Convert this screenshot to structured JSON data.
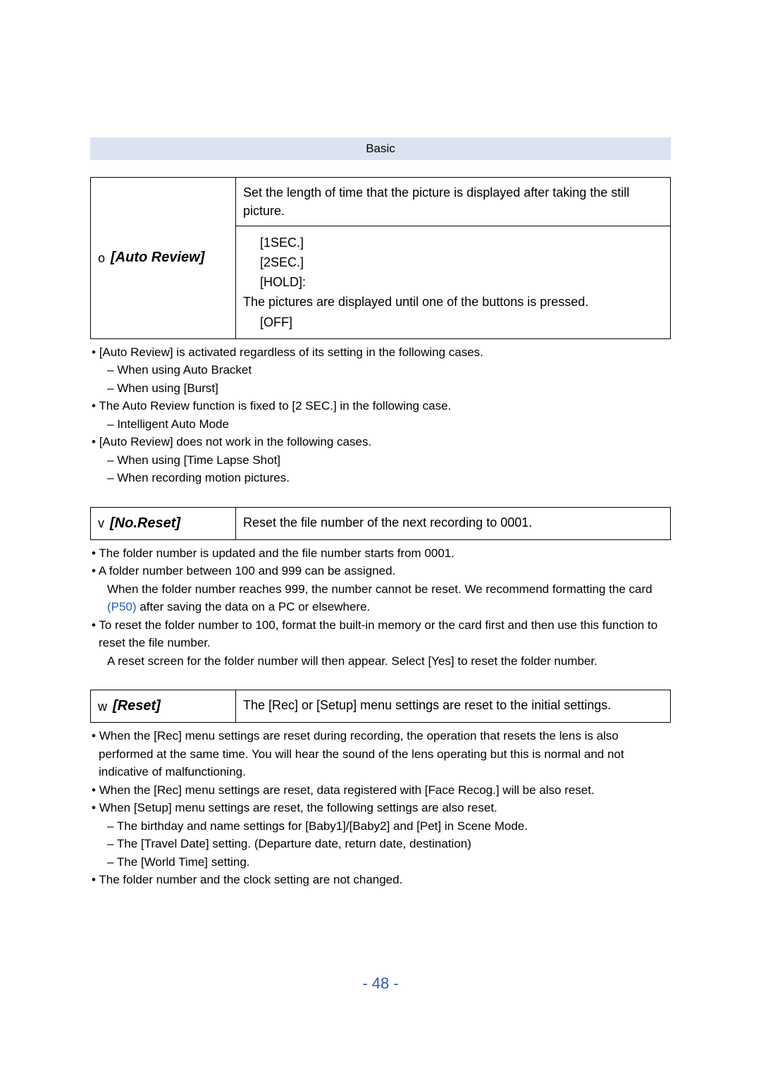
{
  "header": {
    "title": "Basic"
  },
  "section1": {
    "left_letter": "o",
    "left_glyph": "[Auto Review]",
    "desc": "Set the length of time that the picture is displayed after taking the still picture.",
    "options": [
      {
        "g": "",
        "t": "[1SEC.]"
      },
      {
        "g": "",
        "t": "[2SEC.]"
      },
      {
        "g": "",
        "t": "[HOLD]:"
      },
      {
        "g": "",
        "t": "The pictures are displayed until one of the buttons is pressed."
      },
      {
        "g": "",
        "t": "[OFF]"
      }
    ]
  },
  "notes1": {
    "n1": "[Auto Review] is activated regardless of its setting in the following cases.",
    "n1s1": "When using Auto Bracket",
    "n1s2": "When using [Burst]",
    "n2": "The Auto Review function is fixed to [2 SEC.] in the following case.",
    "n2s1": "Intelligent Auto Mode",
    "n3": "[Auto Review] does not work in the following cases.",
    "n3s1": "When using [Time Lapse Shot]",
    "n3s2": "When recording motion pictures."
  },
  "section2": {
    "left_letter": "v",
    "left_glyph": "[No.Reset]",
    "desc": "Reset the file number of the next recording to 0001."
  },
  "notes2": {
    "n1": "The folder number is updated and the file number starts from 0001.",
    "n2": "A folder number between 100 and 999 can be assigned.",
    "n2b_a": "When the folder number reaches 999, the number cannot be reset. We recommend formatting the card ",
    "n2b_link": "(P50)",
    "n2b_c": " after saving the data on a PC or elsewhere.",
    "n3": "To reset the folder number to 100, format the built-in memory or the card first and then use this function to reset the file number.",
    "n3b": "A reset screen for the folder number will then appear. Select [Yes] to reset the folder number."
  },
  "section3": {
    "left_letter": "w",
    "left_glyph": "[Reset]",
    "desc": "The [Rec] or [Setup] menu settings are reset to the initial settings."
  },
  "notes3": {
    "n1": "When the [Rec] menu settings are reset during recording, the operation that resets the lens is also performed at the same time. You will hear the sound of the lens operating but this is normal and not indicative of malfunctioning.",
    "n2": "When the [Rec] menu settings are reset, data registered with [Face Recog.] will be also reset.",
    "n3": "When [Setup] menu settings are reset, the following settings are also reset.",
    "n3s1": "The birthday and name settings for [Baby1]/[Baby2] and [Pet] in Scene Mode.",
    "n3s2": "The [Travel Date] setting. (Departure date, return date, destination)",
    "n3s3": "The [World Time] setting.",
    "n4": "The folder number and the clock setting are not changed."
  },
  "page_number": "- 48 -"
}
